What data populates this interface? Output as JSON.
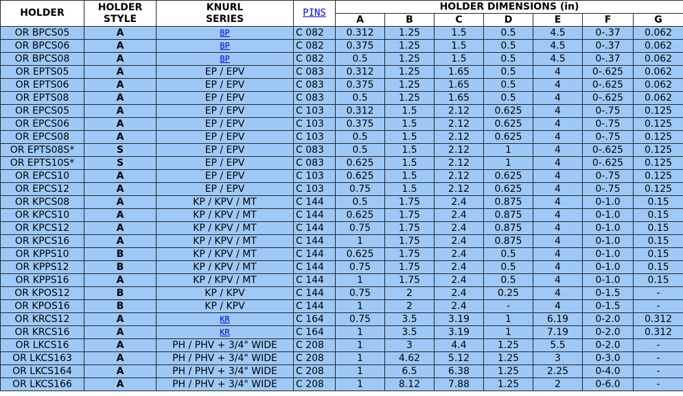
{
  "headers": {
    "holder": "HOLDER",
    "holder_style": [
      "HOLDER",
      "STYLE"
    ],
    "knurl_series": [
      "KNURL",
      "SERIES"
    ],
    "pins": "PINS",
    "dimensions": "HOLDER DIMENSIONS (in)",
    "dims": [
      "A",
      "B",
      "C",
      "D",
      "E",
      "F",
      "G"
    ]
  },
  "rows": [
    {
      "holder": "OR BPCS05",
      "style": "A",
      "series": "BP",
      "series_link": true,
      "pins": "C 082",
      "dims": [
        "0.312",
        "1.25",
        "1.5",
        "0.5",
        "4.5",
        "0-.37",
        "0.062"
      ]
    },
    {
      "holder": "OR BPCS06",
      "style": "A",
      "series": "BP",
      "series_link": true,
      "pins": "C 082",
      "dims": [
        "0.375",
        "1.25",
        "1.5",
        "0.5",
        "4.5",
        "0-.37",
        "0.062"
      ]
    },
    {
      "holder": "OR BPCS08",
      "style": "A",
      "series": "BP",
      "series_link": true,
      "pins": "C 082",
      "dims": [
        "0.5",
        "1.25",
        "1.5",
        "0.5",
        "4.5",
        "0-.37",
        "0.062"
      ]
    },
    {
      "holder": "OR EPTS05",
      "style": "A",
      "series": "EP / EPV",
      "series_link": false,
      "pins": "C 083",
      "dims": [
        "0.312",
        "1.25",
        "1.65",
        "0.5",
        "4",
        "0-.625",
        "0.062"
      ]
    },
    {
      "holder": "OR EPTS06",
      "style": "A",
      "series": "EP / EPV",
      "series_link": false,
      "pins": "C 083",
      "dims": [
        "0.375",
        "1.25",
        "1.65",
        "0.5",
        "4",
        "0-.625",
        "0.062"
      ]
    },
    {
      "holder": "OR EPTS08",
      "style": "A",
      "series": "EP / EPV",
      "series_link": false,
      "pins": "C 083",
      "dims": [
        "0.5",
        "1.25",
        "1.65",
        "0.5",
        "4",
        "0-.625",
        "0.062"
      ]
    },
    {
      "holder": "OR EPCS05",
      "style": "A",
      "series": "EP / EPV",
      "series_link": false,
      "pins": "C 103",
      "dims": [
        "0.312",
        "1.5",
        "2.12",
        "0.625",
        "4",
        "0-.75",
        "0.125"
      ]
    },
    {
      "holder": "OR EPCS06",
      "style": "A",
      "series": "EP / EPV",
      "series_link": false,
      "pins": "C 103",
      "dims": [
        "0.375",
        "1.5",
        "2.12",
        "0.625",
        "4",
        "0-.75",
        "0.125"
      ]
    },
    {
      "holder": "OR EPCS08",
      "style": "A",
      "series": "EP / EPV",
      "series_link": false,
      "pins": "C 103",
      "dims": [
        "0.5",
        "1.5",
        "2.12",
        "0.625",
        "4",
        "0-.75",
        "0.125"
      ]
    },
    {
      "holder": "OR EPTS08S*",
      "style": "S",
      "series": "EP / EPV",
      "series_link": false,
      "pins": "C 083",
      "dims": [
        "0.5",
        "1.5",
        "2.12",
        "1",
        "4",
        "0-.625",
        "0.125"
      ]
    },
    {
      "holder": "OR EPTS10S*",
      "style": "S",
      "series": "EP / EPV",
      "series_link": false,
      "pins": "C 083",
      "dims": [
        "0.625",
        "1.5",
        "2.12",
        "1",
        "4",
        "0-.625",
        "0.125"
      ]
    },
    {
      "holder": "OR EPCS10",
      "style": "A",
      "series": "EP / EPV",
      "series_link": false,
      "pins": "C 103",
      "dims": [
        "0.625",
        "1.5",
        "2.12",
        "0.625",
        "4",
        "0-.75",
        "0.125"
      ]
    },
    {
      "holder": "OR EPCS12",
      "style": "A",
      "series": "EP / EPV",
      "series_link": false,
      "pins": "C 103",
      "dims": [
        "0.75",
        "1.5",
        "2.12",
        "0.625",
        "4",
        "0-.75",
        "0.125"
      ]
    },
    {
      "holder": "OR KPCS08",
      "style": "A",
      "series": "KP / KPV / MT",
      "series_link": false,
      "pins": "C 144",
      "dims": [
        "0.5",
        "1.75",
        "2.4",
        "0.875",
        "4",
        "0-1.0",
        "0.15"
      ]
    },
    {
      "holder": "OR KPCS10",
      "style": "A",
      "series": "KP / KPV / MT",
      "series_link": false,
      "pins": "C 144",
      "dims": [
        "0.625",
        "1.75",
        "2.4",
        "0.875",
        "4",
        "0-1.0",
        "0.15"
      ]
    },
    {
      "holder": "OR KPCS12",
      "style": "A",
      "series": "KP / KPV / MT",
      "series_link": false,
      "pins": "C 144",
      "dims": [
        "0.75",
        "1.75",
        "2.4",
        "0.875",
        "4",
        "0-1.0",
        "0.15"
      ]
    },
    {
      "holder": "OR KPCS16",
      "style": "A",
      "series": "KP / KPV / MT",
      "series_link": false,
      "pins": "C 144",
      "dims": [
        "1",
        "1.75",
        "2.4",
        "0.875",
        "4",
        "0-1.0",
        "0.15"
      ]
    },
    {
      "holder": "OR KPPS10",
      "style": "B",
      "series": "KP / KPV / MT",
      "series_link": false,
      "pins": "C 144",
      "dims": [
        "0.625",
        "1.75",
        "2.4",
        "0.5",
        "4",
        "0-1.0",
        "0.15"
      ]
    },
    {
      "holder": "OR KPPS12",
      "style": "B",
      "series": "KP / KPV / MT",
      "series_link": false,
      "pins": "C 144",
      "dims": [
        "0.75",
        "1.75",
        "2.4",
        "0.5",
        "4",
        "0-1.0",
        "0.15"
      ]
    },
    {
      "holder": "OR KPPS16",
      "style": "A",
      "series": "KP / KPV / MT",
      "series_link": false,
      "pins": "C 144",
      "dims": [
        "1",
        "1.75",
        "2.4",
        "0.5",
        "4",
        "0-1.0",
        "0.15"
      ]
    },
    {
      "holder": "OR KPOS12",
      "style": "B",
      "series": "KP / KPV",
      "series_link": false,
      "pins": "C 144",
      "dims": [
        "0.75",
        "2",
        "2.4",
        "0.25",
        "4",
        "0-1.5",
        "-"
      ]
    },
    {
      "holder": "OR KPOS16",
      "style": "B",
      "series": "KP / KPV",
      "series_link": false,
      "pins": "C 144",
      "dims": [
        "1",
        "2",
        "2.4",
        "-",
        "4",
        "0-1.5",
        "-"
      ]
    },
    {
      "holder": "OR KRCS12",
      "style": "A",
      "series": "KR",
      "series_link": true,
      "pins": "C 164",
      "dims": [
        "0.75",
        "3.5",
        "3.19",
        "1",
        "6.19",
        "0-2.0",
        "0.312"
      ]
    },
    {
      "holder": "OR KRCS16",
      "style": "A",
      "series": "KR",
      "series_link": true,
      "pins": "C 164",
      "dims": [
        "1",
        "3.5",
        "3.19",
        "1",
        "7.19",
        "0-2.0",
        "0.312"
      ]
    },
    {
      "holder": "OR LKCS16",
      "style": "A",
      "series": "PH / PHV + 3/4\" WIDE",
      "series_link": false,
      "pins": "C 208",
      "dims": [
        "1",
        "3",
        "4.4",
        "1.25",
        "5.5",
        "0-2.0",
        "-"
      ]
    },
    {
      "holder": "OR LKCS163",
      "style": "A",
      "series": "PH / PHV + 3/4\" WIDE",
      "series_link": false,
      "pins": "C 208",
      "dims": [
        "1",
        "4.62",
        "5.12",
        "1.25",
        "3",
        "0-3.0",
        "-"
      ]
    },
    {
      "holder": "OR LKCS164",
      "style": "A",
      "series": "PH / PHV + 3/4\" WIDE",
      "series_link": false,
      "pins": "C 208",
      "dims": [
        "1",
        "6.5",
        "6.38",
        "1.25",
        "2.25",
        "0-4.0",
        "-"
      ]
    },
    {
      "holder": "OR LKCS166",
      "style": "A",
      "series": "PH / PHV + 3/4\" WIDE",
      "series_link": false,
      "pins": "C 208",
      "dims": [
        "1",
        "8.12",
        "7.88",
        "1.25",
        "2",
        "0-6.0",
        "-"
      ]
    }
  ]
}
